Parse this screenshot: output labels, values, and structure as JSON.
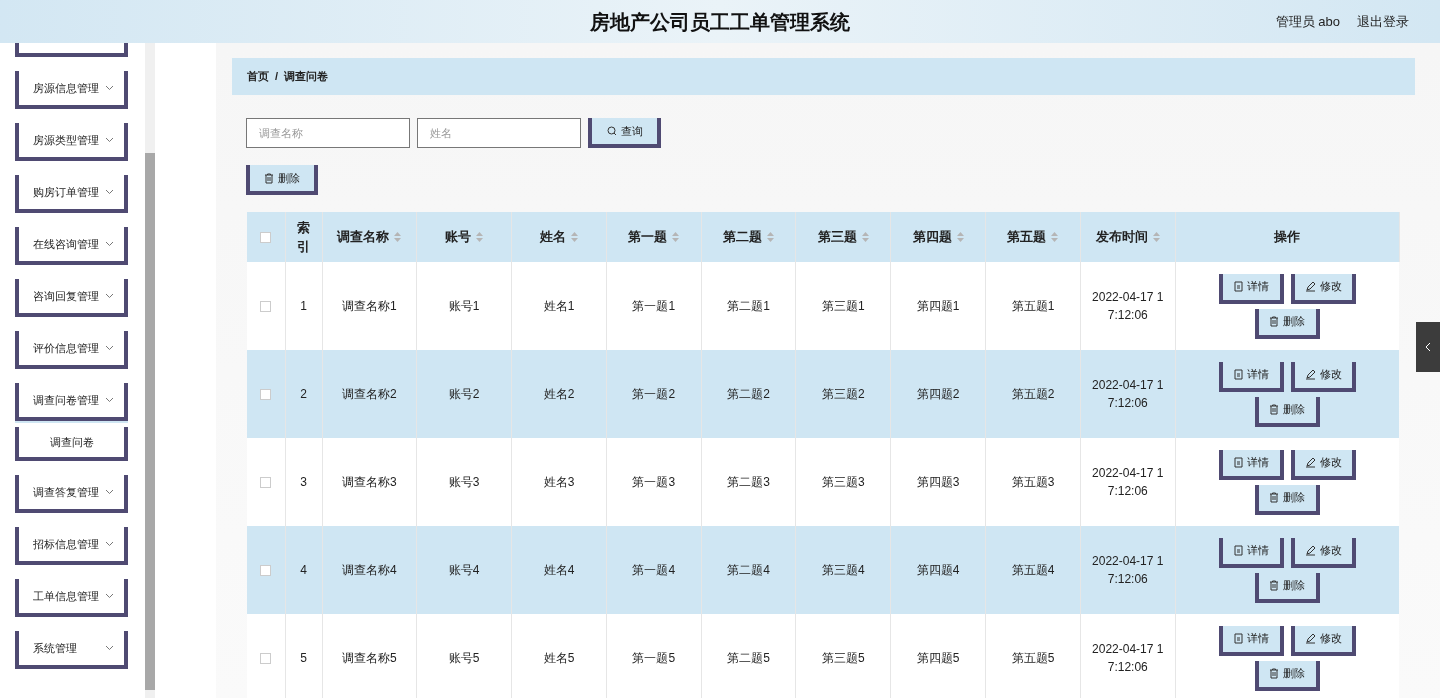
{
  "header": {
    "title": "房地产公司员工工单管理系统",
    "user": "管理员 abo",
    "logout": "退出登录"
  },
  "sidebar": {
    "items": [
      {
        "expanded": false
      },
      {
        "label": "房源信息管理",
        "expanded": false
      },
      {
        "label": "房源类型管理",
        "expanded": false
      },
      {
        "label": "购房订单管理",
        "expanded": false
      },
      {
        "label": "在线咨询管理",
        "expanded": false
      },
      {
        "label": "咨询回复管理",
        "expanded": false
      },
      {
        "label": "评价信息管理",
        "expanded": false
      },
      {
        "label": "调查问卷管理",
        "expanded": true,
        "children": [
          {
            "label": "调查问卷"
          }
        ]
      },
      {
        "label": "调查答复管理",
        "expanded": false
      },
      {
        "label": "招标信息管理",
        "expanded": false
      },
      {
        "label": "工单信息管理",
        "expanded": false
      },
      {
        "label": "系统管理",
        "expanded": false
      }
    ]
  },
  "breadcrumb": [
    "首页",
    "/",
    "调查问卷"
  ],
  "search": {
    "fields": [
      {
        "placeholder": "调查名称"
      },
      {
        "placeholder": "姓名"
      }
    ],
    "button": "查询"
  },
  "bulk_delete": "删除",
  "table": {
    "select_all_checked": false,
    "columns": [
      {
        "label": "索引",
        "sortable": false
      },
      {
        "label": "调查名称",
        "sortable": true
      },
      {
        "label": "账号",
        "sortable": true
      },
      {
        "label": "姓名",
        "sortable": true
      },
      {
        "label": "第一题",
        "sortable": true
      },
      {
        "label": "第二题",
        "sortable": true
      },
      {
        "label": "第三题",
        "sortable": true
      },
      {
        "label": "第四题",
        "sortable": true
      },
      {
        "label": "第五题",
        "sortable": true
      },
      {
        "label": "发布时间",
        "sortable": true
      },
      {
        "label": "操作",
        "sortable": false
      }
    ],
    "rows": [
      {
        "checked": false,
        "cells": [
          "1",
          "调查名称1",
          "账号1",
          "姓名1",
          "第一题1",
          "第二题1",
          "第三题1",
          "第四题1",
          "第五题1",
          "2022-04-17 17:12:06"
        ],
        "actions": [
          "详情",
          "修改",
          "删除"
        ]
      },
      {
        "checked": false,
        "cells": [
          "2",
          "调查名称2",
          "账号2",
          "姓名2",
          "第一题2",
          "第二题2",
          "第三题2",
          "第四题2",
          "第五题2",
          "2022-04-17 17:12:06"
        ],
        "actions": [
          "详情",
          "修改",
          "删除"
        ]
      },
      {
        "checked": false,
        "cells": [
          "3",
          "调查名称3",
          "账号3",
          "姓名3",
          "第一题3",
          "第二题3",
          "第三题3",
          "第四题3",
          "第五题3",
          "2022-04-17 17:12:06"
        ],
        "actions": [
          "详情",
          "修改",
          "删除"
        ]
      },
      {
        "checked": false,
        "cells": [
          "4",
          "调查名称4",
          "账号4",
          "姓名4",
          "第一题4",
          "第二题4",
          "第三题4",
          "第四题4",
          "第五题4",
          "2022-04-17 17:12:06"
        ],
        "actions": [
          "详情",
          "修改",
          "删除"
        ]
      },
      {
        "checked": false,
        "cells": [
          "5",
          "调查名称5",
          "账号5",
          "姓名5",
          "第一题5",
          "第二题5",
          "第三题5",
          "第四题5",
          "第五题5",
          "2022-04-17 17:12:06"
        ],
        "actions": [
          "详情",
          "修改",
          "删除"
        ]
      }
    ]
  }
}
